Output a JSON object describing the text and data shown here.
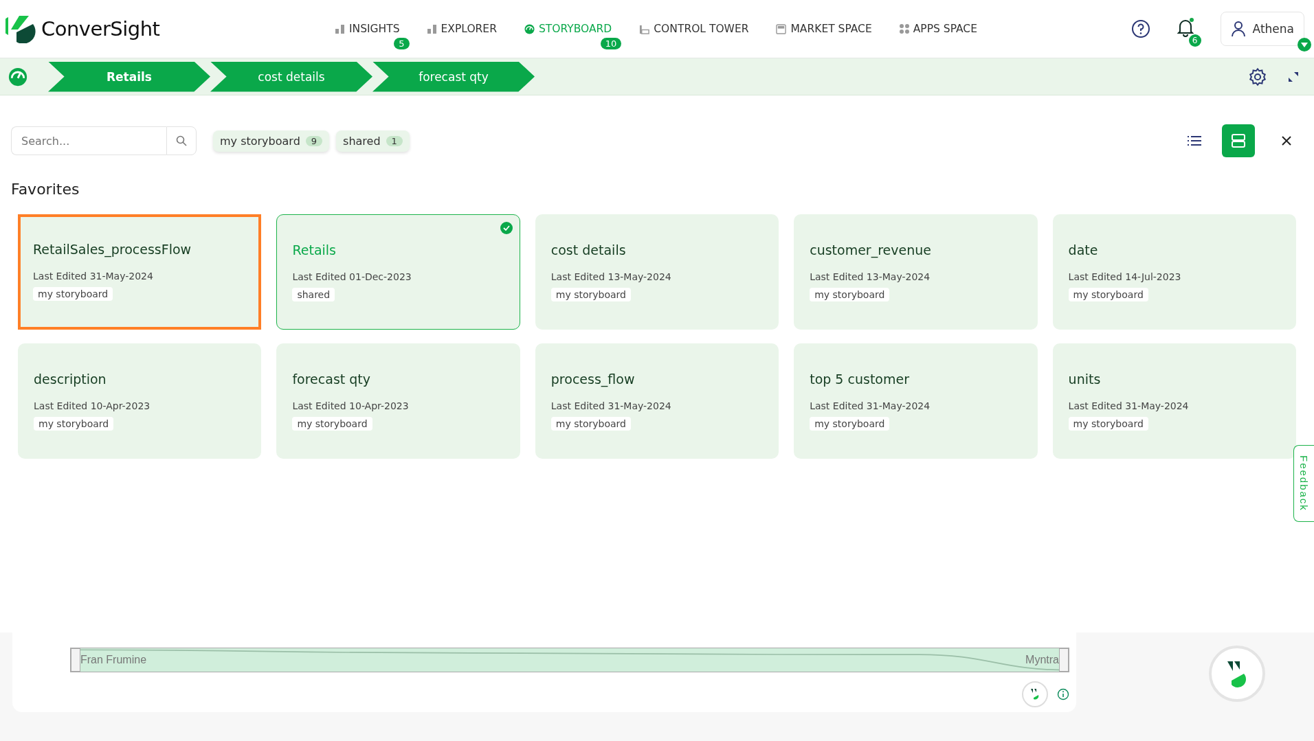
{
  "app": {
    "name": "ConverSight"
  },
  "nav": [
    {
      "label": "INSIGHTS",
      "kind": "bars",
      "badge": "5",
      "selected": false
    },
    {
      "label": "EXPLORER",
      "kind": "bars",
      "selected": false
    },
    {
      "label": "STORYBOARD",
      "kind": "gauge",
      "badge": "10",
      "selected": true
    },
    {
      "label": "CONTROL TOWER",
      "kind": "tower",
      "selected": false
    },
    {
      "label": "MARKET SPACE",
      "kind": "store",
      "selected": false
    },
    {
      "label": "APPS SPACE",
      "kind": "dots",
      "selected": false
    }
  ],
  "notifications": {
    "count": "6"
  },
  "user": {
    "name": "Athena"
  },
  "breadcrumbs": [
    {
      "label": "Retails",
      "selected": true
    },
    {
      "label": "cost details",
      "selected": false
    },
    {
      "label": "forecast qty",
      "selected": false
    }
  ],
  "search": {
    "placeholder": "Search..."
  },
  "filters": [
    {
      "label": "my storyboard",
      "count": "9"
    },
    {
      "label": "shared",
      "count": "1"
    }
  ],
  "views": [
    {
      "kind": "list",
      "selected": false
    },
    {
      "kind": "cards",
      "selected": true
    }
  ],
  "section_title": "Favorites",
  "cards": [
    {
      "title": "RetailSales_processFlow",
      "edited": "Last Edited 31-May-2024",
      "tag": "my storyboard",
      "selected": false,
      "highlighted": true
    },
    {
      "title": "Retails",
      "edited": "Last Edited 01-Dec-2023",
      "tag": "shared",
      "selected": true,
      "highlighted": false
    },
    {
      "title": "cost details",
      "edited": "Last Edited 13-May-2024",
      "tag": "my storyboard",
      "selected": false,
      "highlighted": false
    },
    {
      "title": "customer_revenue",
      "edited": "Last Edited 13-May-2024",
      "tag": "my storyboard",
      "selected": false,
      "highlighted": false
    },
    {
      "title": "date",
      "edited": "Last Edited 14-Jul-2023",
      "tag": "my storyboard",
      "selected": false,
      "highlighted": false
    },
    {
      "title": "description",
      "edited": "Last Edited 10-Apr-2023",
      "tag": "my storyboard",
      "selected": false,
      "highlighted": false
    },
    {
      "title": "forecast qty",
      "edited": "Last Edited 10-Apr-2023",
      "tag": "my storyboard",
      "selected": false,
      "highlighted": false
    },
    {
      "title": "process_flow",
      "edited": "Last Edited 31-May-2024",
      "tag": "my storyboard",
      "selected": false,
      "highlighted": false
    },
    {
      "title": "top 5 customer",
      "edited": "Last Edited 31-May-2024",
      "tag": "my storyboard",
      "selected": false,
      "highlighted": false
    },
    {
      "title": "units",
      "edited": "Last Edited 31-May-2024",
      "tag": "my storyboard",
      "selected": false,
      "highlighted": false
    }
  ],
  "range_slider": {
    "start_label": "Fran Frumine",
    "end_label": "Myntra",
    "level": 1
  },
  "feedback": {
    "label": "Feedback"
  }
}
